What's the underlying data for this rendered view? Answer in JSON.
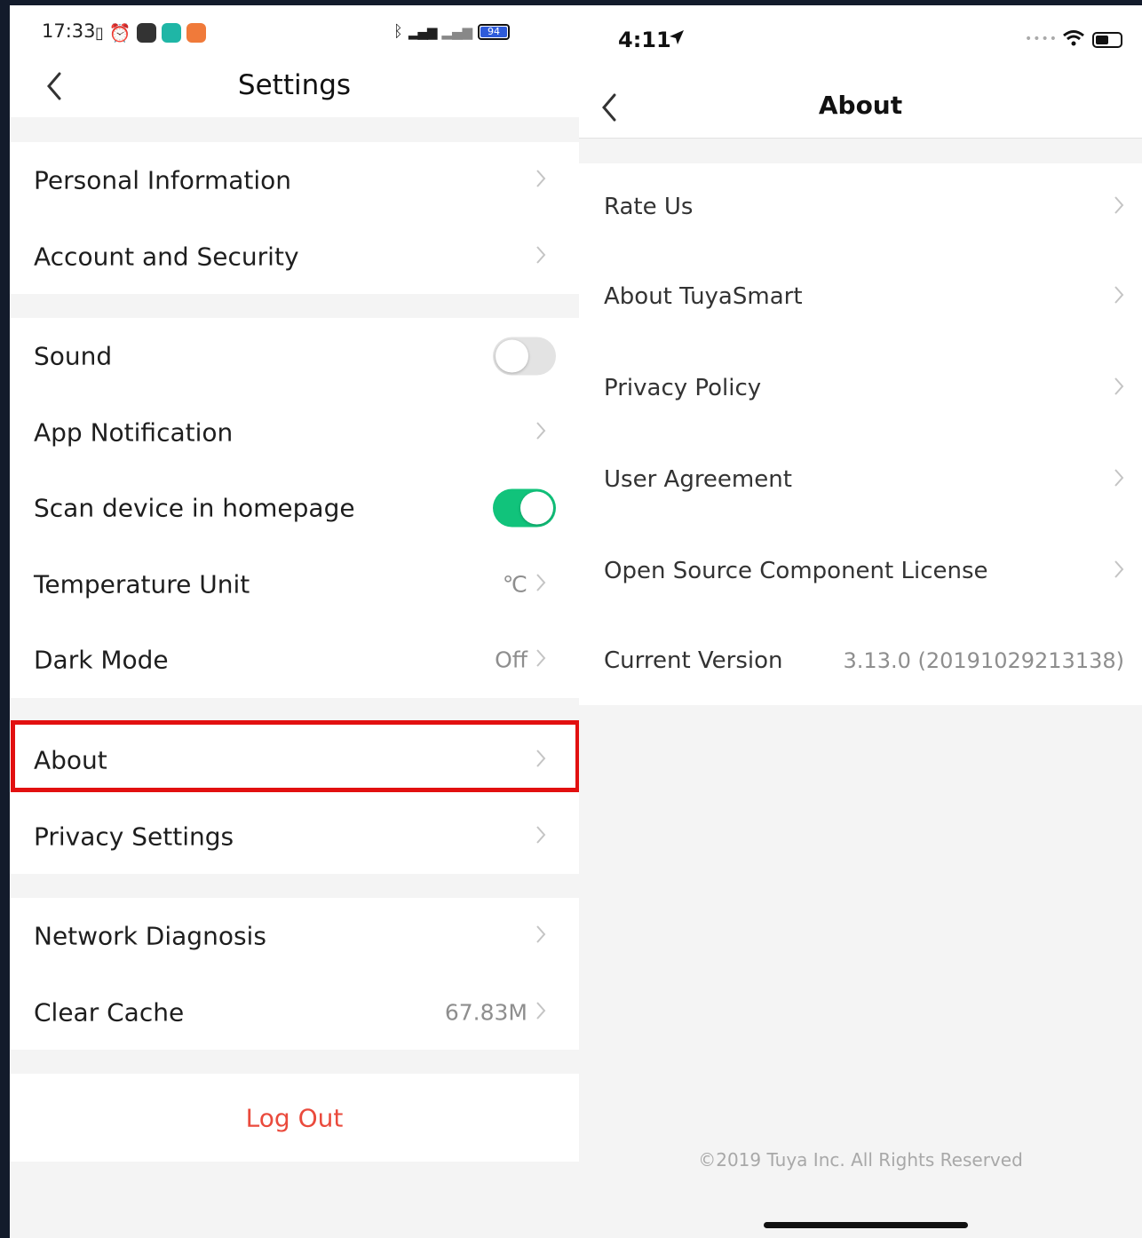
{
  "left": {
    "status": {
      "time": "17:33",
      "battery": "94"
    },
    "title": "Settings",
    "sections": [
      {
        "rows": [
          {
            "label": "Personal Information"
          },
          {
            "label": "Account and Security"
          }
        ]
      },
      {
        "rows": [
          {
            "label": "Sound",
            "toggle": "off"
          },
          {
            "label": "App Notification"
          },
          {
            "label": "Scan device in homepage",
            "toggle": "on"
          },
          {
            "label": "Temperature Unit",
            "value": "℃"
          },
          {
            "label": "Dark Mode",
            "value": "Off"
          },
          {
            "label": "About"
          },
          {
            "label": "Privacy Settings"
          }
        ]
      },
      {
        "rows": [
          {
            "label": "Network Diagnosis"
          },
          {
            "label": "Clear Cache",
            "value": "67.83M"
          }
        ]
      }
    ],
    "logout": "Log Out"
  },
  "right": {
    "status": {
      "time": "4:11"
    },
    "title": "About",
    "rows": [
      {
        "label": "Rate Us"
      },
      {
        "label": "About TuyaSmart"
      },
      {
        "label": "Privacy Policy"
      },
      {
        "label": "User Agreement"
      },
      {
        "label": "Open Source Component License"
      },
      {
        "label": "Current Version",
        "value": "3.13.0 (20191029213138)"
      }
    ],
    "footer": "©2019 Tuya Inc. All Rights Reserved"
  },
  "colors": {
    "highlight": "#e21010",
    "toggle_on": "#11c37b",
    "logout": "#ea4a3c"
  }
}
